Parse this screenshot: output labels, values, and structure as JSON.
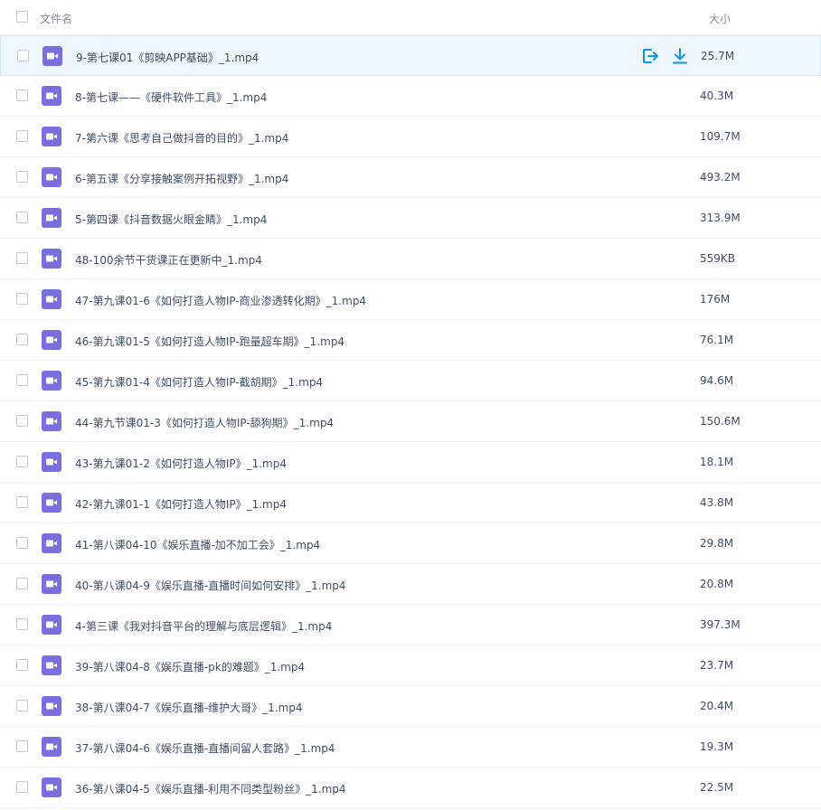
{
  "header": {
    "name_label": "文件名",
    "size_label": "大小"
  },
  "colors": {
    "file_icon": "#7b6fe0",
    "action_icon": "#0d95e6",
    "hover_bg": "#f0f6fd"
  },
  "files": [
    {
      "name": "9-第七课01《剪映APP基础》_1.mp4",
      "size": "25.7M"
    },
    {
      "name": "8-第七课——《硬件软件工具》_1.mp4",
      "size": "40.3M"
    },
    {
      "name": "7-第六课《思考自己做抖音的目的》_1.mp4",
      "size": "109.7M"
    },
    {
      "name": "6-第五课《分享接触案例开拓视野》_1.mp4",
      "size": "493.2M"
    },
    {
      "name": "5-第四课《抖音数据火眼金睛》_1.mp4",
      "size": "313.9M"
    },
    {
      "name": "48-100余节干货课正在更新中_1.mp4",
      "size": "559KB"
    },
    {
      "name": "47-第九课01-6《如何打造人物IP-商业渗透转化期》_1.mp4",
      "size": "176M"
    },
    {
      "name": "46-第九课01-5《如何打造人物IP-跑量超车期》_1.mp4",
      "size": "76.1M"
    },
    {
      "name": "45-第九课01-4《如何打造人物IP-截胡期》_1.mp4",
      "size": "94.6M"
    },
    {
      "name": "44-第九节课01-3《如何打造人物IP-舔狗期》_1.mp4",
      "size": "150.6M"
    },
    {
      "name": "43-第九课01-2《如何打造人物IP》_1.mp4",
      "size": "18.1M"
    },
    {
      "name": "42-第九课01-1《如何打造人物IP》_1.mp4",
      "size": "43.8M"
    },
    {
      "name": "41-第八课04-10《娱乐直播-加不加工会》_1.mp4",
      "size": "29.8M"
    },
    {
      "name": "40-第八课04-9《娱乐直播-直播时间如何安排》_1.mp4",
      "size": "20.8M"
    },
    {
      "name": "4-第三课《我对抖音平台的理解与底层逻辑》_1.mp4",
      "size": "397.3M"
    },
    {
      "name": "39-第八课04-8《娱乐直播-pk的难题》_1.mp4",
      "size": "23.7M"
    },
    {
      "name": "38-第八课04-7《娱乐直播-维护大哥》_1.mp4",
      "size": "20.4M"
    },
    {
      "name": "37-第八课04-6《娱乐直播-直播间留人套路》_1.mp4",
      "size": "19.3M"
    },
    {
      "name": "36-第八课04-5《娱乐直播-利用不同类型粉丝》_1.mp4",
      "size": "22.5M"
    }
  ]
}
